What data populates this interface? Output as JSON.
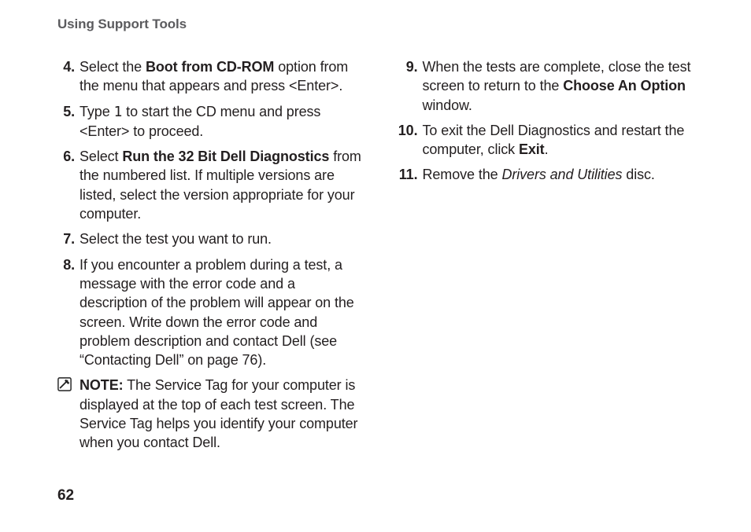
{
  "header": "Using Support Tools",
  "page_number": "62",
  "col1": [
    {
      "num": "4.",
      "parts": [
        {
          "t": "Select the "
        },
        {
          "t": "Boot from CD-ROM",
          "b": true
        },
        {
          "t": " option from the menu that appears and press <Enter>."
        }
      ]
    },
    {
      "num": "5.",
      "parts": [
        {
          "t": "Type "
        },
        {
          "t": "1",
          "m": true
        },
        {
          "t": " to start the CD menu and press <Enter> to proceed."
        }
      ]
    },
    {
      "num": "6.",
      "parts": [
        {
          "t": "Select "
        },
        {
          "t": "Run the 32 Bit Dell Diagnostics",
          "b": true
        },
        {
          "t": " from the numbered list. If multiple versions are listed, select the version appropriate for your  computer."
        }
      ]
    },
    {
      "num": "7.",
      "parts": [
        {
          "t": "Select the test you want to run."
        }
      ]
    },
    {
      "num": "8.",
      "parts": [
        {
          "t": "If you encounter a problem during a test, a message with the error code and a description of the problem will appear on the screen. Write down the error code and problem description and contact Dell (see “Contacting Dell” on page 76)."
        }
      ]
    }
  ],
  "note": {
    "label": "NOTE:",
    "text": " The Service Tag for your computer is displayed at the top of each test screen. The Service Tag helps you identify your computer when you contact Dell."
  },
  "col2": [
    {
      "num": "9.",
      "parts": [
        {
          "t": "When the tests are complete, close the test screen to return to the "
        },
        {
          "t": "Choose An Option",
          "b": true
        },
        {
          "t": " window."
        }
      ]
    },
    {
      "num": "10.",
      "parts": [
        {
          "t": "To exit the Dell Diagnostics and restart the computer, click "
        },
        {
          "t": "Exit",
          "b": true
        },
        {
          "t": "."
        }
      ]
    },
    {
      "num": "11.",
      "parts": [
        {
          "t": "Remove the "
        },
        {
          "t": "Drivers and Utilities",
          "i": true
        },
        {
          "t": " disc."
        }
      ]
    }
  ]
}
